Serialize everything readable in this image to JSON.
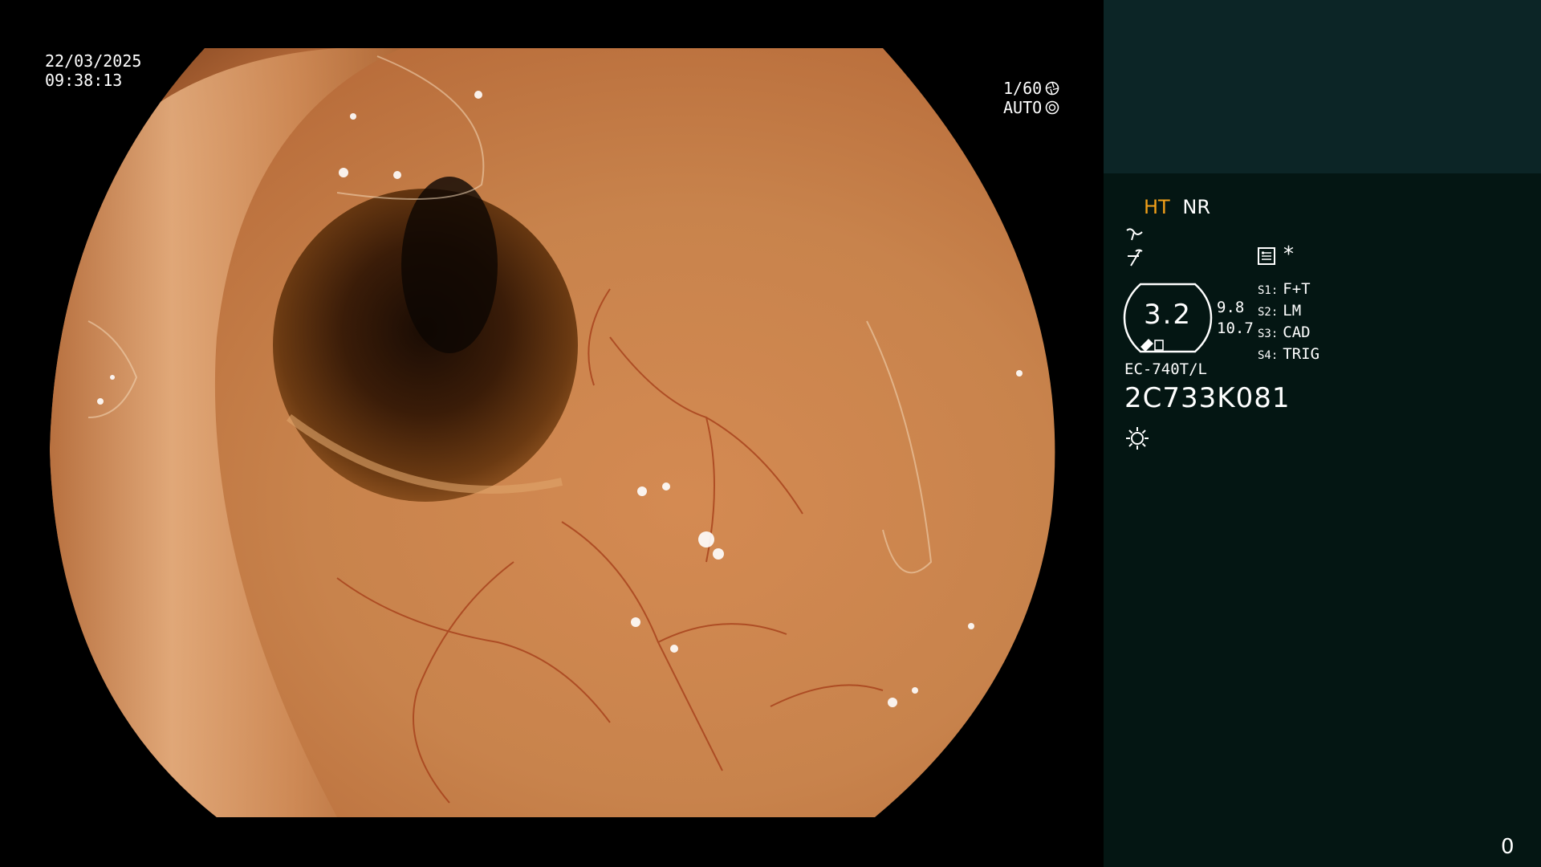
{
  "overlay": {
    "date": "22/03/2025",
    "time": "09:38:13",
    "shutter": "1/60",
    "exposure_mode": "AUTO"
  },
  "side_panel": {
    "mode_ht": "HT",
    "mode_nr": "NR",
    "icons": {
      "enhancement": "structure-enhancement-icon",
      "color": "color-mode-icon",
      "menu": "menu-list-icon",
      "asterisk": "*",
      "light": "light-sun-icon"
    },
    "zoom_value": "3.2",
    "zoom_sub_a": "9.8",
    "zoom_sub_b": "10.7",
    "scope_settings": [
      {
        "key": "S1:",
        "value": "F+T"
      },
      {
        "key": "S2:",
        "value": "LM"
      },
      {
        "key": "S3:",
        "value": "CAD"
      },
      {
        "key": "S4:",
        "value": "TRIG"
      }
    ],
    "scope_model": "EC-740T/L",
    "scope_serial": "2C733K081",
    "frame_counter": "0"
  },
  "colors": {
    "panel_top": "#0c2526",
    "panel_bottom": "#041613",
    "highlight_orange": "#f2a019"
  }
}
